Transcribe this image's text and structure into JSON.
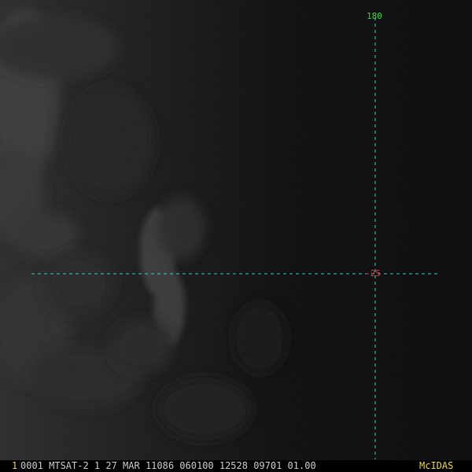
{
  "grid": {
    "longitude_label": "180",
    "latitude_label": "-25",
    "line_color": "#2ec7c7",
    "longitude_label_color": "#3fd43f",
    "latitude_label_color": "#e03030"
  },
  "status_bar": {
    "frame_number": "1",
    "frame_info": "0001 MTSAT-2      1 27 MAR 11086 060100 12528 09701 01.00",
    "brand": "McIDAS",
    "frame_number_color": "#e6d23a",
    "text_color": "#c8c8c8",
    "brand_color": "#e6d23a"
  }
}
